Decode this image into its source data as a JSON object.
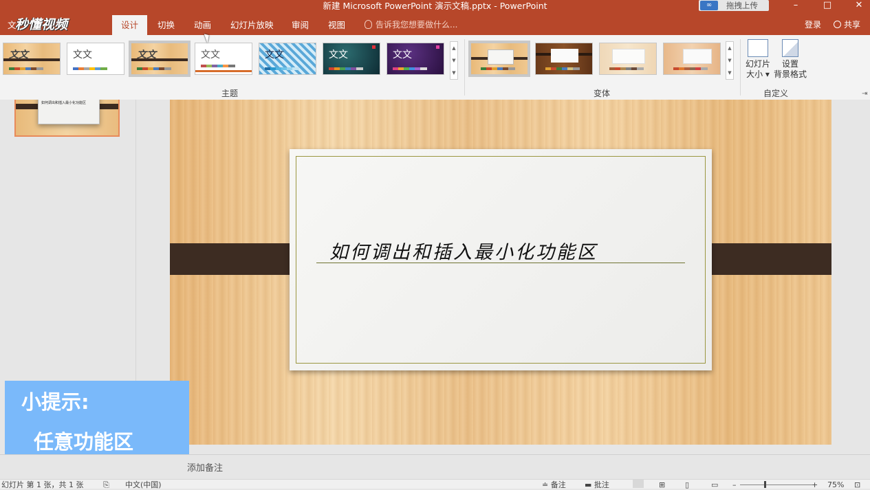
{
  "window": {
    "title": "新建 Microsoft PowerPoint 演示文稿.pptx - PowerPoint",
    "upload_label": "拖拽上传",
    "minimize": "–",
    "maximize": "□",
    "close": "✕"
  },
  "tabs": {
    "file": "文",
    "brand": "秒懂视频",
    "design": "设计",
    "transitions": "切换",
    "animations": "动画",
    "slideshow": "幻灯片放映",
    "review": "审阅",
    "view": "视图",
    "tellme": "告诉我您想要做什么...",
    "login": "登录",
    "share": "共享"
  },
  "ribbon": {
    "themes_label": "主题",
    "variants_label": "变体",
    "customize_label": "自定义",
    "theme_sample_text": "文文",
    "slide_size_label_1": "幻灯片",
    "slide_size_label_2": "大小 ▾",
    "bg_format_label_1": "设置",
    "bg_format_label_2": "背景格式"
  },
  "slide": {
    "title": "如何调出和插入最小化功能区"
  },
  "tip": {
    "line1": "小提示:",
    "line2": "任意功能区"
  },
  "notes": {
    "placeholder": "添加备注"
  },
  "status": {
    "slide_info": "幻灯片 第 1 张，共 1 张",
    "language": "中文(中国)",
    "notes_btn": "≐ 备注",
    "comments_btn": "▬ 批注",
    "zoom_minus": "–",
    "zoom_plus": "+",
    "zoom_level": "75%"
  },
  "colors": {
    "accent": "#b7472a",
    "tip_bg": "#7ab9fa",
    "strap": "#3d2c22"
  }
}
